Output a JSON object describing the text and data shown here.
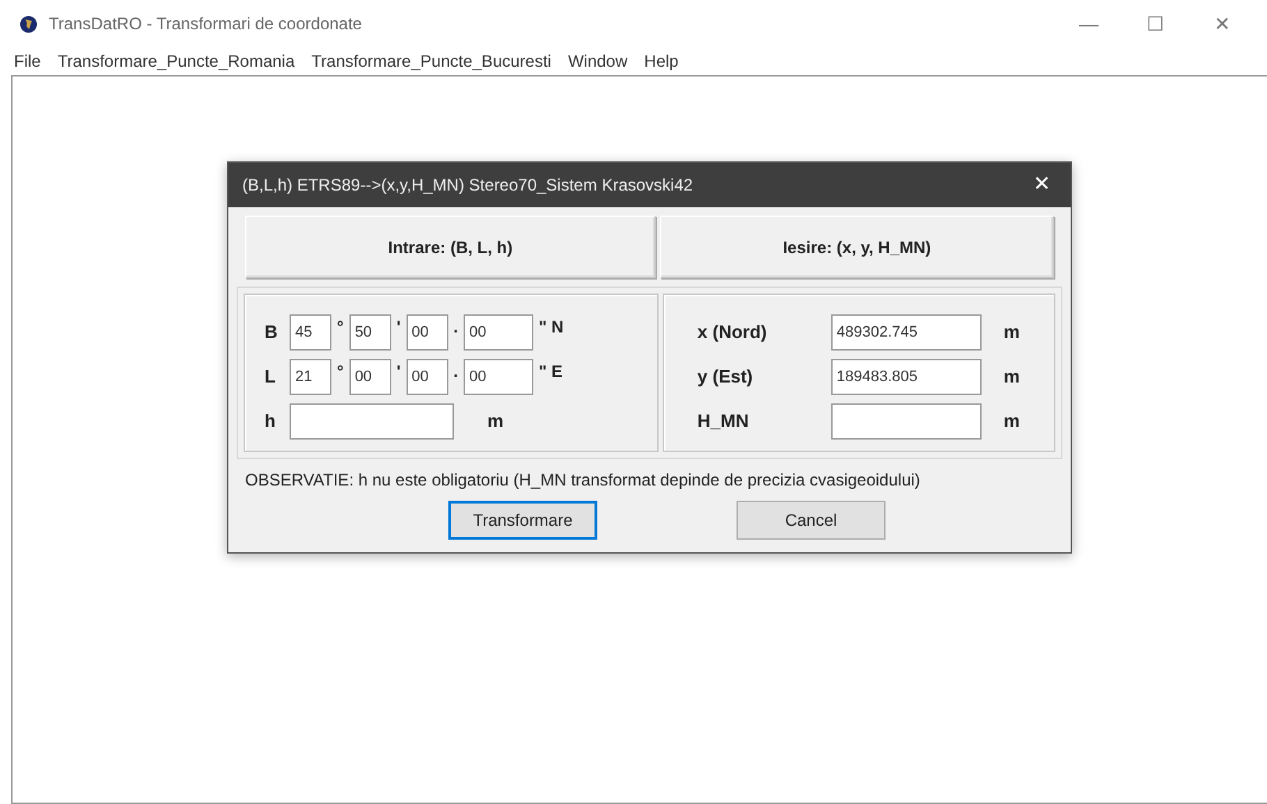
{
  "window": {
    "title": "TransDatRO - Transformari de coordonate",
    "controls": [
      "—",
      "☐",
      "✕"
    ]
  },
  "menu": [
    "File",
    "Transformare_Puncte_Romania",
    "Transformare_Puncte_Bucuresti",
    "Window",
    "Help"
  ],
  "dialog": {
    "title": "(B,L,h) ETRS89-->(x,y,H_MN) Stereo70_Sistem Krasovski42",
    "close": "✕",
    "headers": [
      "Intrare: (B, L, h)",
      "Iesire: (x, y, H_MN)"
    ],
    "input_rows": [
      {
        "label": "B",
        "items": [
          {
            "kind": "field",
            "value": "45"
          },
          {
            "kind": "sep",
            "text": "°"
          },
          {
            "kind": "field",
            "value": "50"
          },
          {
            "kind": "sep",
            "text": "'"
          },
          {
            "kind": "field",
            "value": "00"
          },
          {
            "kind": "sep",
            "text": "."
          },
          {
            "kind": "field",
            "value": "00"
          },
          {
            "kind": "sep",
            "text": "\" N"
          }
        ]
      },
      {
        "label": "L",
        "items": [
          {
            "kind": "field",
            "value": "21"
          },
          {
            "kind": "sep",
            "text": "°"
          },
          {
            "kind": "field",
            "value": "00"
          },
          {
            "kind": "sep",
            "text": "'"
          },
          {
            "kind": "field",
            "value": "00"
          },
          {
            "kind": "sep",
            "text": "."
          },
          {
            "kind": "field",
            "value": "00"
          },
          {
            "kind": "sep",
            "text": "\" E"
          }
        ]
      },
      {
        "label": "h",
        "items": [
          {
            "kind": "field"
          },
          {
            "kind": "unit",
            "text": "m"
          }
        ]
      }
    ],
    "output_rows": [
      {
        "label": "x (Nord)",
        "value": "489302.745",
        "unit": "m"
      },
      {
        "label": "y (Est)",
        "value": "189483.805",
        "unit": "m"
      },
      {
        "label": "H_MN",
        "unit": "m"
      }
    ],
    "note": "OBSERVATIE: h nu este obligatoriu (H_MN transformat depinde de precizia cvasigeoidului)",
    "buttons": [
      {
        "label": "Transformare",
        "default": true
      },
      {
        "label": "Cancel",
        "default": false
      }
    ]
  }
}
